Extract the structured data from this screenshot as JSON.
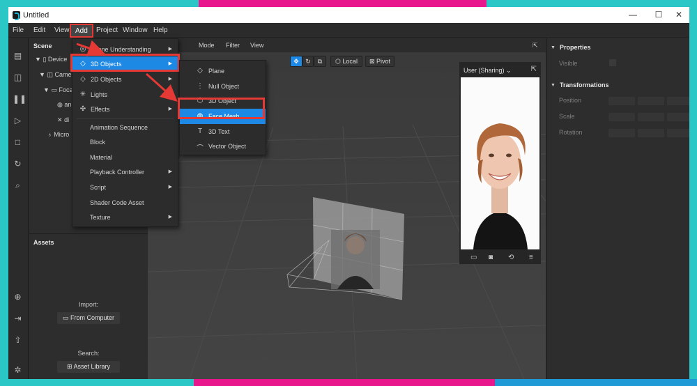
{
  "window": {
    "title": "Untitled",
    "controls": [
      "—",
      "☐",
      "✕"
    ]
  },
  "menubar": [
    {
      "id": "file",
      "label": "File"
    },
    {
      "id": "edit",
      "label": "Edit"
    },
    {
      "id": "view",
      "label": "View"
    },
    {
      "id": "add",
      "label": "Add"
    },
    {
      "id": "project",
      "label": "Project"
    },
    {
      "id": "window",
      "label": "Window"
    },
    {
      "id": "help",
      "label": "Help"
    }
  ],
  "scene": {
    "header": "Scene",
    "tree": [
      {
        "label": "Device",
        "expander": "▼"
      },
      {
        "label": "Came",
        "expander": "▼"
      },
      {
        "label": "Foca",
        "expander": "▼"
      },
      {
        "label": "an",
        "expander": ""
      },
      {
        "label": "di",
        "expander": ""
      },
      {
        "label": "Micro",
        "expander": ""
      }
    ]
  },
  "assets": {
    "header": "Assets",
    "import_label": "Import:",
    "from_computer": "From Computer",
    "search_label": "Search:",
    "asset_library": "Asset Library"
  },
  "viewport": {
    "toolbar": [
      "Mode",
      "Filter",
      "View"
    ],
    "gizmo": {
      "local": "Local",
      "pivot": "Pivot"
    },
    "preview_title": "User (Sharing)"
  },
  "add_menu": {
    "items": [
      {
        "label": "Scene Understanding",
        "icon": "scene-understanding-icon",
        "glyph": "◎",
        "arrow": "▶",
        "highlight": false
      },
      {
        "label": "3D Objects",
        "icon": "3d-objects-icon",
        "glyph": "◇",
        "arrow": "▶",
        "highlight": true
      },
      {
        "label": "2D Objects",
        "icon": "2d-objects-icon",
        "glyph": "◇",
        "arrow": "▶",
        "highlight": false
      },
      {
        "label": "Lights",
        "icon": "lights-icon",
        "glyph": "✳",
        "arrow": "▶",
        "highlight": false
      },
      {
        "label": "Effects",
        "icon": "effects-icon",
        "glyph": "✣",
        "arrow": "▶",
        "highlight": false
      },
      {
        "label": "Animation Sequence",
        "icon": "",
        "glyph": "",
        "arrow": "",
        "highlight": false
      },
      {
        "label": "Block",
        "icon": "",
        "glyph": "",
        "arrow": "",
        "highlight": false
      },
      {
        "label": "Material",
        "icon": "",
        "glyph": "",
        "arrow": "",
        "highlight": false
      },
      {
        "label": "Playback Controller",
        "icon": "",
        "glyph": "",
        "arrow": "▶",
        "highlight": false
      },
      {
        "label": "Script",
        "icon": "",
        "glyph": "",
        "arrow": "▶",
        "highlight": false
      },
      {
        "label": "Shader Code Asset",
        "icon": "",
        "glyph": "",
        "arrow": "",
        "highlight": false
      },
      {
        "label": "Texture",
        "icon": "",
        "glyph": "",
        "arrow": "▶",
        "highlight": false
      }
    ]
  },
  "submenu_3d": {
    "items": [
      {
        "label": "Plane",
        "icon": "plane-icon",
        "glyph": "◇",
        "highlight": false
      },
      {
        "label": "Null Object",
        "icon": "null-object-icon",
        "glyph": "⋮",
        "highlight": false
      },
      {
        "label": "3D Object",
        "icon": "3d-object-icon",
        "glyph": "⬡",
        "highlight": false
      },
      {
        "label": "Face Mesh",
        "icon": "face-mesh-icon",
        "glyph": "◍",
        "highlight": true
      },
      {
        "label": "3D Text",
        "icon": "3d-text-icon",
        "glyph": "T",
        "highlight": false
      },
      {
        "label": "Vector Object",
        "icon": "vector-object-icon",
        "glyph": "⌒",
        "highlight": false
      }
    ]
  },
  "properties": {
    "header": "Properties",
    "visible": "Visible",
    "transformations": "Transformations",
    "position": "Position",
    "scale": "Scale",
    "rotation": "Rotation"
  },
  "colors": {
    "accent": "#1e88e5",
    "annotation": "#e53935",
    "panel": "#2d2d2d",
    "viewport": "#3f3f3f"
  }
}
